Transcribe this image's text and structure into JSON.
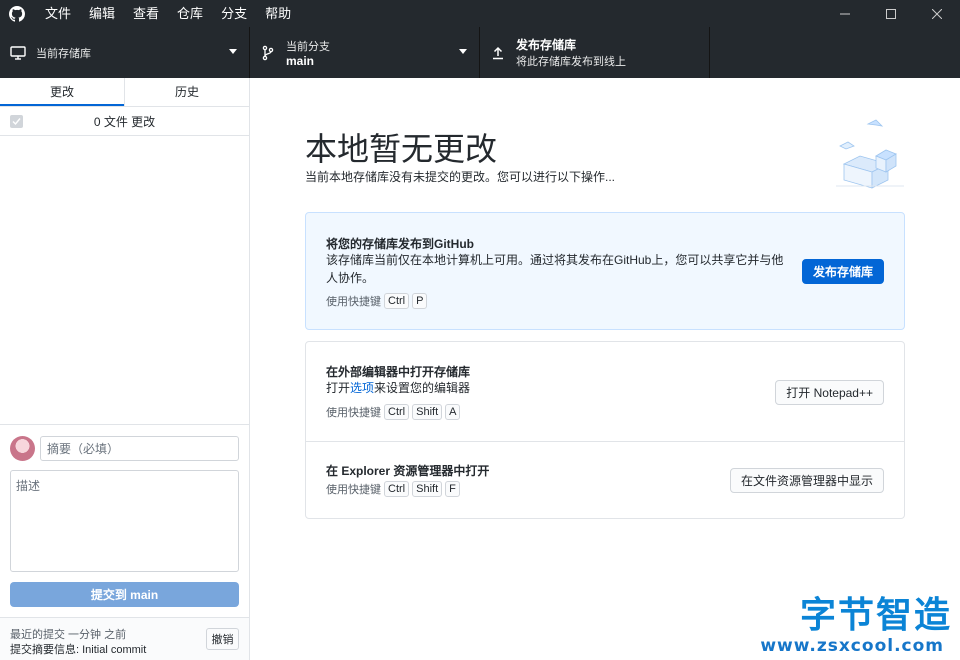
{
  "menu": [
    "文件",
    "编辑",
    "查看",
    "仓库",
    "分支",
    "帮助"
  ],
  "toolbar": {
    "repo_label": "当前存储库",
    "repo_value": "",
    "branch_label": "当前分支",
    "branch_value": "main",
    "publish_title": "发布存储库",
    "publish_sub": "将此存储库发布到线上"
  },
  "sidebar": {
    "tabs": [
      "更改",
      "历史"
    ],
    "changes_count": "0 文件 更改",
    "commit": {
      "summary_placeholder": "摘要（必填）",
      "description_placeholder": "描述",
      "button_label": "提交到 main"
    },
    "last_commit": {
      "line1": "最近的提交 一分钟 之前",
      "line2": "提交摘要信息: Initial commit",
      "undo_label": "撤销"
    }
  },
  "main": {
    "title": "本地暂无更改",
    "subtitle": "当前本地存储库没有未提交的更改。您可以进行以下操作...",
    "cards": {
      "publish": {
        "title": "将您的存储库发布到GitHub",
        "desc": "该存储库当前仅在本地计算机上可用。通过将其发布在GitHub上，您可以共享它并与他人协作。",
        "shortcut_label": "使用快捷键",
        "keys": [
          "Ctrl",
          "P"
        ],
        "button": "发布存储库"
      },
      "editor": {
        "title": "在外部编辑器中打开存储库",
        "desc_prefix": "打开",
        "desc_link": "选项",
        "desc_suffix": "来设置您的编辑器",
        "shortcut_label": "使用快捷键",
        "keys": [
          "Ctrl",
          "Shift",
          "A"
        ],
        "button": "打开 Notepad++"
      },
      "explorer": {
        "title": "在 Explorer 资源管理器中打开",
        "shortcut_label": "使用快捷键",
        "keys": [
          "Ctrl",
          "Shift",
          "F"
        ],
        "button": "在文件资源管理器中显示"
      }
    }
  },
  "watermark": {
    "cn": "字节智造",
    "en": "www.zsxcool.com"
  },
  "colors": {
    "titlebar": "#24292e",
    "accent": "#0366d6",
    "commit_button_disabled": "#79a6dc",
    "highlight_card": "#f1f8ff"
  }
}
